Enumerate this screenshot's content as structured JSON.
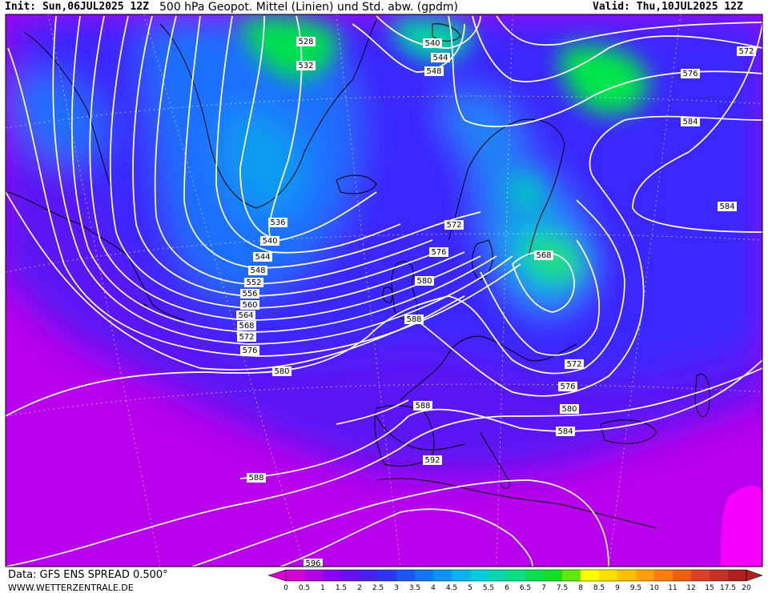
{
  "header": {
    "init": "Init: Sun,06JUL2025 12Z",
    "title": "500 hPa Geopot. Mittel (Linien) und Std. abw. (gpdm)",
    "valid": "Valid: Thu,10JUL2025 12Z"
  },
  "footer": {
    "data": "Data: GFS ENS SPREAD 0.500°",
    "site": "WWW.WETTERZENTRALE.DE"
  },
  "colors": {
    "background_low_spread": "#c800f0",
    "mid_spread": "#3a2bff",
    "high_spread": "#00e64b",
    "contour": "#ffffff"
  },
  "colorbar": {
    "ticks": [
      "0",
      "0.5",
      "1",
      "1.5",
      "2",
      "2.5",
      "3",
      "3.5",
      "4",
      "4.5",
      "5",
      "5.5",
      "6",
      "6.5",
      "7",
      "7.5",
      "8",
      "8.5",
      "9",
      "9.5",
      "10",
      "11",
      "12",
      "15",
      "17.5",
      "20"
    ],
    "colors": [
      "#d400d4",
      "#b000e8",
      "#8a00f2",
      "#6a10f5",
      "#4a20f8",
      "#2a35ff",
      "#1a55ff",
      "#1075f5",
      "#0095f0",
      "#00b5f0",
      "#00cce0",
      "#00d8b0",
      "#00e080",
      "#00e050",
      "#10e020",
      "#60ea00",
      "#ffff00",
      "#ffe000",
      "#ffc000",
      "#ffa000",
      "#ff8000",
      "#f06000",
      "#e04020",
      "#c83020",
      "#b02020"
    ]
  },
  "contour_labels": [
    "528",
    "532",
    "536",
    "540",
    "544",
    "548",
    "552",
    "556",
    "560",
    "564",
    "568",
    "572",
    "576",
    "580",
    "584",
    "588",
    "592",
    "596"
  ]
}
